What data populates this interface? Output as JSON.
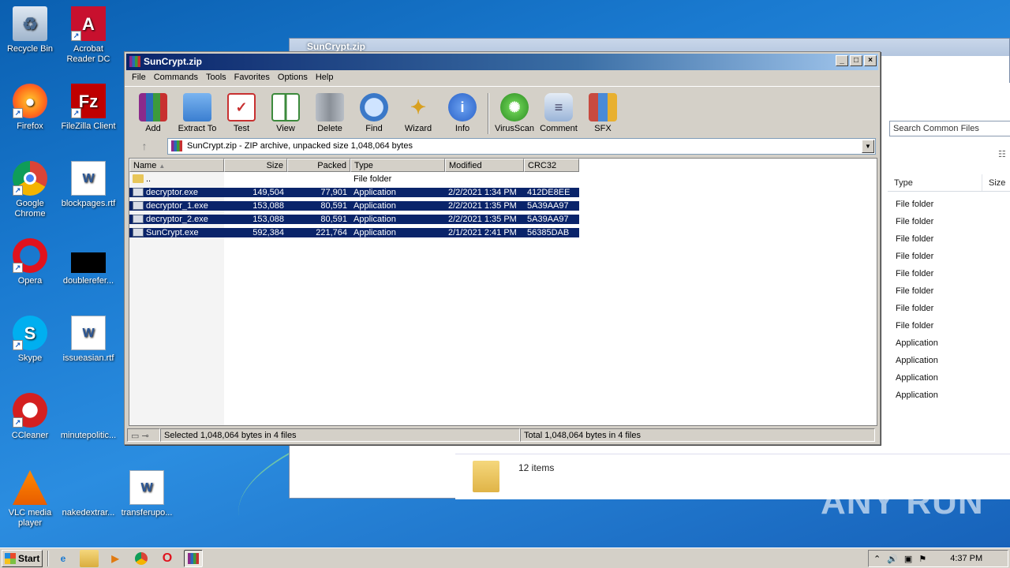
{
  "desktop": {
    "icons": [
      {
        "label": "Recycle Bin"
      },
      {
        "label": "Acrobat Reader DC"
      },
      {
        "label": "Firefox"
      },
      {
        "label": "FileZilla Client"
      },
      {
        "label": "Google Chrome"
      },
      {
        "label": "blockpages.rtf"
      },
      {
        "label": "Opera"
      },
      {
        "label": "doublerefer..."
      },
      {
        "label": "Skype"
      },
      {
        "label": "issueasian.rtf"
      },
      {
        "label": "CCleaner"
      },
      {
        "label": "minutepolitic..."
      },
      {
        "label": "VLC media player"
      },
      {
        "label": "nakedextrar..."
      },
      {
        "label": "transferupo..."
      }
    ]
  },
  "bg_window": {
    "title": "SunCrypt.zip",
    "search_placeholder": "Search Common Files",
    "col_type": "Type",
    "col_size": "Size",
    "types": [
      "File folder",
      "File folder",
      "File folder",
      "File folder",
      "File folder",
      "File folder",
      "File folder",
      "File folder",
      "Application",
      "Application",
      "Application",
      "Application"
    ],
    "items_count": "12 items"
  },
  "winrar": {
    "title": "SunCrypt.zip",
    "menu": [
      "File",
      "Commands",
      "Tools",
      "Favorites",
      "Options",
      "Help"
    ],
    "toolbar": [
      {
        "label": "Add",
        "icon": "add-icon",
        "color": "#8b2a8b"
      },
      {
        "label": "Extract To",
        "icon": "extract-folder-icon",
        "color": "#3a7ed0"
      },
      {
        "label": "Test",
        "icon": "test-clipboard-icon",
        "color": "#c83030"
      },
      {
        "label": "View",
        "icon": "view-book-icon",
        "color": "#3c8a3c"
      },
      {
        "label": "Delete",
        "icon": "trash-icon",
        "color": "#8a9098"
      },
      {
        "label": "Find",
        "icon": "magnifier-icon",
        "color": "#3a78c8"
      },
      {
        "label": "Wizard",
        "icon": "wand-icon",
        "color": "#b0b0b0"
      },
      {
        "label": "Info",
        "icon": "info-icon",
        "color": "#2a62c8"
      },
      {
        "label": "VirusScan",
        "icon": "virus-icon",
        "color": "#3aa030"
      },
      {
        "label": "Comment",
        "icon": "comment-icon",
        "color": "#6a8ab8"
      },
      {
        "label": "SFX",
        "icon": "sfx-icon",
        "color": "#c84a40"
      }
    ],
    "address": "SunCrypt.zip - ZIP archive, unpacked size 1,048,064 bytes",
    "columns": {
      "name": "Name",
      "size": "Size",
      "packed": "Packed",
      "type": "Type",
      "modified": "Modified",
      "crc": "CRC32"
    },
    "rows": [
      {
        "name": "..",
        "size": "",
        "packed": "",
        "type": "File folder",
        "modified": "",
        "crc": "",
        "selected": false,
        "icon": "folder"
      },
      {
        "name": "decryptor.exe",
        "size": "149,504",
        "packed": "77,901",
        "type": "Application",
        "modified": "2/2/2021 1:34 PM",
        "crc": "412DE8EE",
        "selected": true,
        "icon": "exe"
      },
      {
        "name": "decryptor_1.exe",
        "size": "153,088",
        "packed": "80,591",
        "type": "Application",
        "modified": "2/2/2021 1:35 PM",
        "crc": "5A39AA97",
        "selected": true,
        "icon": "exe"
      },
      {
        "name": "decryptor_2.exe",
        "size": "153,088",
        "packed": "80,591",
        "type": "Application",
        "modified": "2/2/2021 1:35 PM",
        "crc": "5A39AA97",
        "selected": true,
        "icon": "exe"
      },
      {
        "name": "SunCrypt.exe",
        "size": "592,384",
        "packed": "221,764",
        "type": "Application",
        "modified": "2/1/2021 2:41 PM",
        "crc": "56385DAB",
        "selected": true,
        "icon": "exe"
      }
    ],
    "status_left": "Selected 1,048,064 bytes in 4 files",
    "status_right": "Total 1,048,064 bytes in 4 files"
  },
  "taskbar": {
    "start_label": "Start",
    "clock": "4:37 PM"
  },
  "watermark": "ANY RUN"
}
